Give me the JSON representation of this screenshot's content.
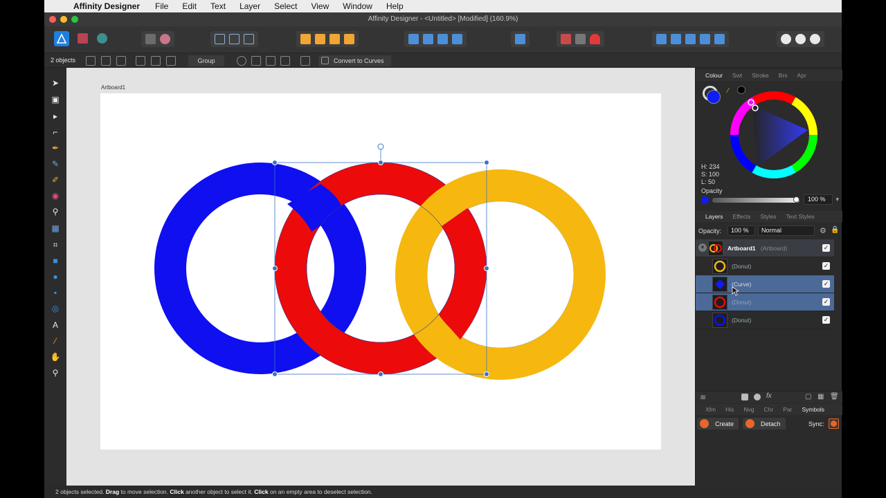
{
  "menubar": {
    "app_name": "Affinity Designer",
    "items": [
      "File",
      "Edit",
      "Text",
      "Layer",
      "Select",
      "View",
      "Window",
      "Help"
    ]
  },
  "window": {
    "title": "Affinity Designer - <Untitled> [Modified] (160.9%)"
  },
  "context_toolbar": {
    "selection_count": "2 objects",
    "group_label": "Group",
    "convert_label": "Convert to Curves"
  },
  "canvas": {
    "artboard_label": "Artboard1",
    "colors": {
      "blue": "#0f0ff0",
      "red": "#ec0a0a",
      "yellow": "#f6b80f",
      "selection": "#3b73c5"
    }
  },
  "colour_panel": {
    "tabs": [
      "Colour",
      "Swt",
      "Stroke",
      "Brs",
      "Apr"
    ],
    "active_tab": "Colour",
    "hue": "H: 234",
    "saturation": "S: 100",
    "lightness": "L: 50",
    "opacity_label": "Opacity",
    "opacity_value": "100 %",
    "opacity_fraction": 1.0,
    "fill_color": "#0f1cf5"
  },
  "layers_panel": {
    "tabs": [
      "Layers",
      "Effects",
      "Styles",
      "Text Styles"
    ],
    "active_tab": "Layers",
    "opacity_label": "Opacity:",
    "opacity_value": "100 %",
    "blend_mode": "Normal",
    "artboard": {
      "name": "Artboard1",
      "type": "(Artboard)"
    },
    "layers": [
      {
        "name": "(Donut)",
        "color": "#f6b80f",
        "selected": false
      },
      {
        "name": "(Curve)",
        "color": "#0f1cf5",
        "selected": true
      },
      {
        "name": "(Donut)",
        "color": "#ec0a0a",
        "selected": true
      },
      {
        "name": "(Donut)",
        "color": "#0f0ff0",
        "selected": false
      }
    ]
  },
  "bottom_panel": {
    "tabs": [
      "Xfm",
      "His",
      "Nvg",
      "Chr",
      "Par",
      "Symbols"
    ],
    "active_tab": "Symbols",
    "create_label": "Create",
    "detach_label": "Detach",
    "sync_label": "Sync:"
  },
  "statusbar": {
    "part1": "2 objects selected. ",
    "drag": "Drag",
    "part2": " to move selection. ",
    "click1": "Click",
    "part3": " another object to select it. ",
    "click2": "Click",
    "part4": " on an empty area to deselect selection."
  }
}
